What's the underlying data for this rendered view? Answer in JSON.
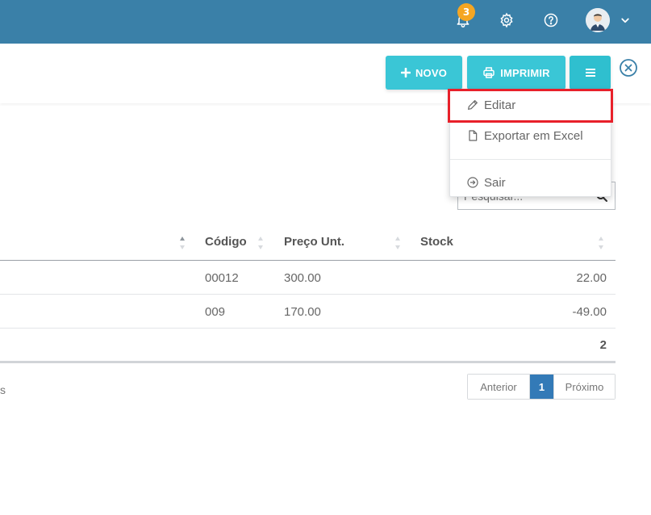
{
  "header": {
    "notification_count": "3",
    "colors": {
      "bar": "#3a80a8",
      "badge": "#f5a623"
    }
  },
  "toolbar": {
    "novo_label": "NOVO",
    "imprimir_label": "IMPRIMIR",
    "accent": "#3ac6d6"
  },
  "dropdown": {
    "items": [
      {
        "label": "Editar",
        "icon": "pencil-icon"
      },
      {
        "label": "Exportar em Excel",
        "icon": "file-icon"
      },
      {
        "label": "Sair",
        "icon": "circle-arrow-right-icon"
      }
    ],
    "highlight_color": "#e8202a"
  },
  "search": {
    "placeholder": "Pesquisar..."
  },
  "table": {
    "columns": [
      "Código",
      "Preço Unt.",
      "Stock"
    ],
    "rows": [
      {
        "codigo": "00012",
        "preco": "300.00",
        "stock": "22.00"
      },
      {
        "codigo": "009",
        "preco": "170.00",
        "stock": "-49.00"
      }
    ],
    "total": "2"
  },
  "info_fragment": "s",
  "pagination": {
    "prev": "Anterior",
    "current": "1",
    "next": "Próximo",
    "active_color": "#337ab7"
  }
}
